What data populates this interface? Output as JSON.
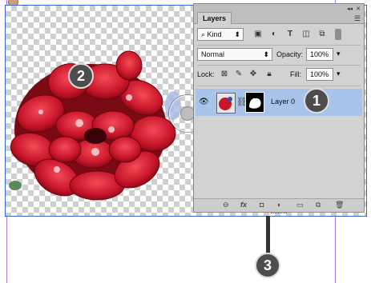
{
  "panel": {
    "tab_label": "Layers",
    "filter": {
      "kind_label": "Kind"
    },
    "blend_mode": "Normal",
    "opacity_label": "Opacity:",
    "opacity_value": "100%",
    "lock_label": "Lock:",
    "fill_label": "Fill:",
    "fill_value": "100%",
    "layers": [
      {
        "name": "Layer 0",
        "visible": true,
        "selected": true
      }
    ],
    "bottom_tools": [
      "link-icon",
      "fx-icon",
      "mask-icon",
      "adjustment-icon",
      "folder-icon",
      "new-layer-icon",
      "trash-icon"
    ]
  },
  "markers": [
    {
      "label": "1"
    },
    {
      "label": "2"
    },
    {
      "label": "3"
    }
  ],
  "colors": {
    "selection": "#a8c4ea",
    "guide": "#a57be0",
    "canvas_border": "#3a6ac0",
    "marker_bg": "#4d4d4d"
  }
}
